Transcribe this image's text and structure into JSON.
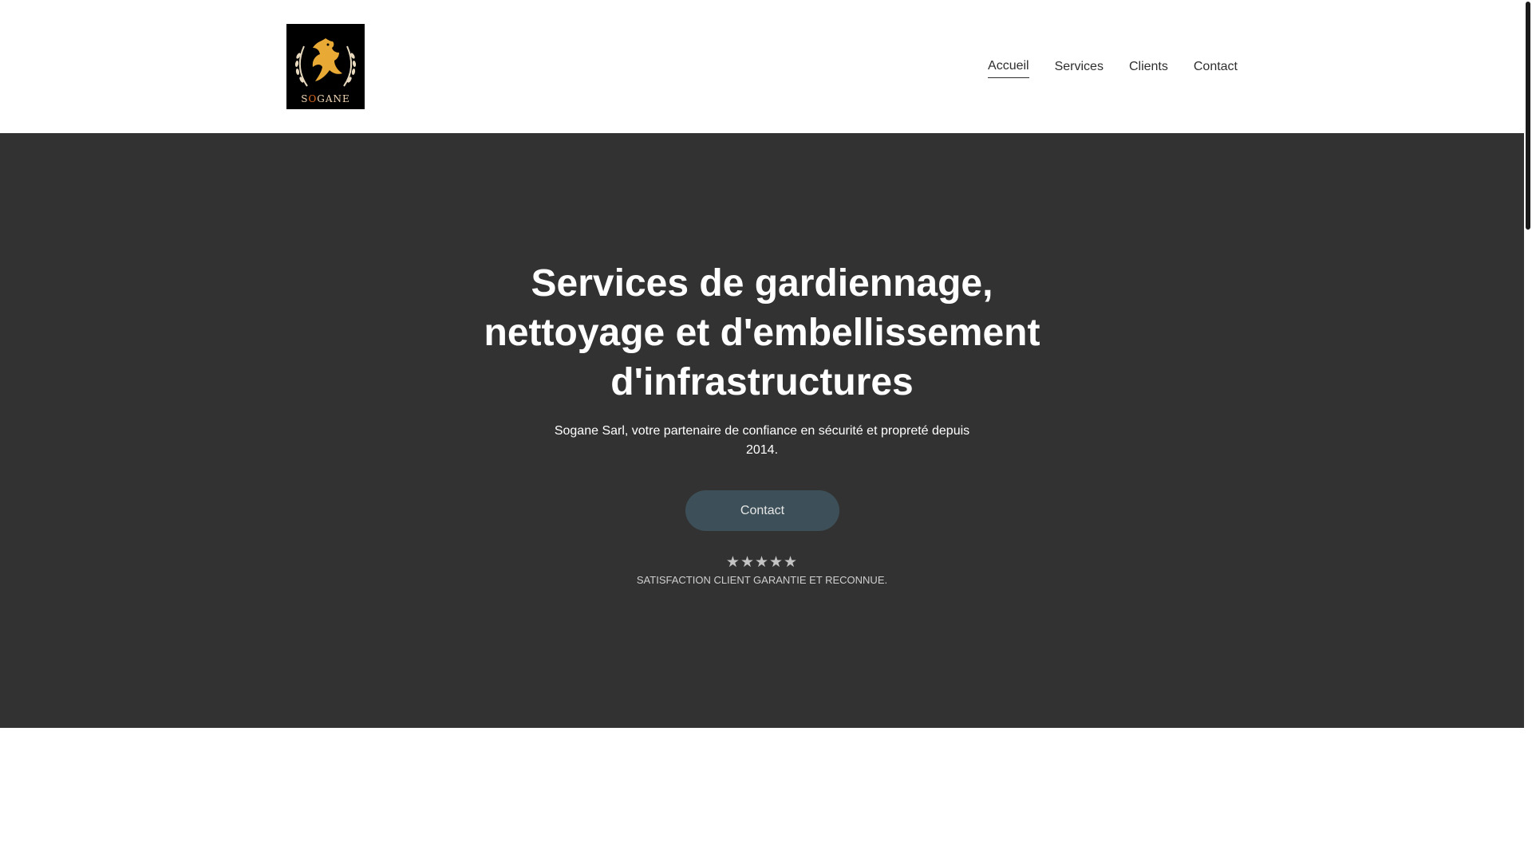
{
  "brand": {
    "logo_text_prefix": "S",
    "logo_text_accent": "O",
    "logo_text_suffix": "GANE",
    "colors": {
      "background": "#000000",
      "emblem": "#e8a935",
      "accent": "#e06a1c"
    }
  },
  "nav": {
    "items": [
      {
        "label": "Accueil",
        "active": true
      },
      {
        "label": "Services",
        "active": false
      },
      {
        "label": "Clients",
        "active": false
      },
      {
        "label": "Contact",
        "active": false
      }
    ]
  },
  "hero": {
    "background": "#323232",
    "title": "Services de gardiennage, nettoyage et d'embellissement d'infrastructures",
    "subtitle": "Sogane Sarl, votre partenaire de confiance en sécurité et propreté depuis 2014.",
    "cta_label": "Contact",
    "rating": {
      "value": 5,
      "max": 5,
      "stars_text": "★★★★★"
    },
    "tagline": "SATISFACTION CLIENT GARANTIE ET RECONNUE."
  },
  "icons": {
    "logo": "eagle-laurel-emblem",
    "rating": "star-icon"
  }
}
